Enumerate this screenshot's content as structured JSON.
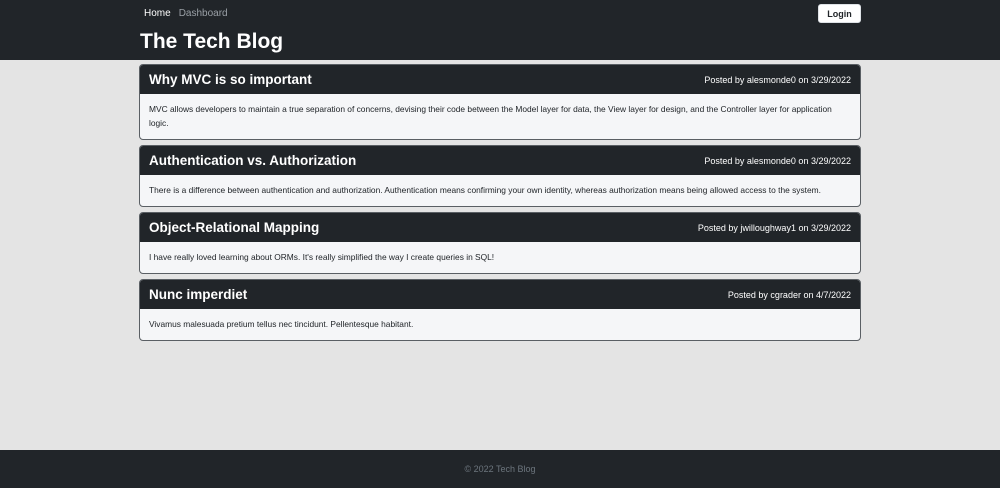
{
  "nav": {
    "home_label": "Home",
    "dashboard_label": "Dashboard",
    "login_label": "Login"
  },
  "header": {
    "site_title": "The Tech Blog"
  },
  "posts": [
    {
      "title": "Why MVC is so important",
      "meta": "Posted by alesmonde0 on 3/29/2022",
      "body": "MVC allows developers to maintain a true separation of concerns, devising their code between the Model layer for data, the View layer for design, and the Controller layer for application logic."
    },
    {
      "title": "Authentication vs. Authorization",
      "meta": "Posted by alesmonde0 on 3/29/2022",
      "body": "There is a difference between authentication and authorization. Authentication means confirming your own identity, whereas authorization means being allowed access to the system."
    },
    {
      "title": "Object-Relational Mapping",
      "meta": "Posted by jwilloughway1 on 3/29/2022",
      "body": "I have really loved learning about ORMs. It's really simplified the way I create queries in SQL!"
    },
    {
      "title": "Nunc imperdiet",
      "meta": "Posted by cgrader on 4/7/2022",
      "body": "Vivamus malesuada pretium tellus nec tincidunt. Pellentesque habitant."
    }
  ],
  "footer": {
    "text": "© 2022 Tech Blog"
  }
}
